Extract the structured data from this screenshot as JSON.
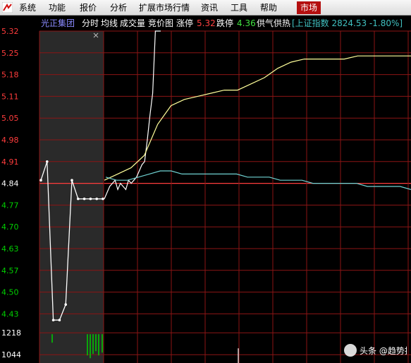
{
  "menu": {
    "items": [
      "系统",
      "功能",
      "报价",
      "分析",
      "扩展市场行情",
      "资讯",
      "工具",
      "帮助"
    ],
    "active": "市场"
  },
  "header": {
    "stock_name": "光正集团",
    "tabs": [
      "分时",
      "均线",
      "成交量",
      "竞价图"
    ],
    "limit_up_label": "涨停",
    "limit_up_value": "5.32",
    "limit_down_label": "跌停",
    "limit_down_value": "4.36",
    "supply_demand": "供气供热",
    "index_info": "[上证指数 2824.53 -1.80%]"
  },
  "colors": {
    "grid": "#8b1515",
    "up": "#ff3c3c",
    "down": "#00d000",
    "price_line": "#ffffff",
    "avg_line": "#ffff9a",
    "index_line": "#6fd2d2",
    "bid_panel": "#2a2a2a",
    "active_menu": "#b40f0f"
  },
  "chart_data": {
    "type": "line",
    "y_ticks": [
      "5.32",
      "5.25",
      "5.18",
      "5.11",
      "5.05",
      "4.98",
      "4.91",
      "4.84",
      "4.77",
      "4.70",
      "4.63",
      "4.57",
      "4.50",
      "4.43"
    ],
    "prev_close": 4.84,
    "ylim": [
      4.36,
      5.32
    ],
    "volume_ticks": [
      "1218",
      "1044"
    ],
    "auction": {
      "label": "竞价",
      "price": [
        4.84,
        4.9,
        4.39,
        4.39,
        4.44,
        4.84,
        4.78,
        4.78,
        4.78,
        4.78,
        4.78
      ]
    },
    "series": [
      {
        "key": "price",
        "values": [
          4.78,
          4.8,
          4.82,
          4.83,
          4.84,
          4.81,
          4.83,
          4.82,
          4.81,
          4.84,
          4.83,
          4.84,
          4.85,
          4.87,
          4.89,
          4.9,
          4.97,
          5.05,
          5.12,
          5.32,
          5.32,
          5.32
        ]
      },
      {
        "key": "avg",
        "values": [
          4.84,
          4.86,
          4.88,
          4.92,
          5.02,
          5.08,
          5.1,
          5.11,
          5.12,
          5.13,
          5.13,
          5.15,
          5.17,
          5.2,
          5.22,
          5.23,
          5.23,
          5.23,
          5.23,
          5.24,
          5.24,
          5.24,
          5.24,
          5.24
        ]
      },
      {
        "key": "index",
        "values": [
          4.85,
          4.84,
          4.84,
          4.85,
          4.86,
          4.87,
          4.87,
          4.86,
          4.86,
          4.86,
          4.86,
          4.86,
          4.86,
          4.85,
          4.85,
          4.85,
          4.84,
          4.84,
          4.84,
          4.83,
          4.83,
          4.83,
          4.83,
          4.83,
          4.82,
          4.82,
          4.82,
          4.82,
          4.81
        ]
      }
    ]
  },
  "watermark": "头条 @趋势投资"
}
